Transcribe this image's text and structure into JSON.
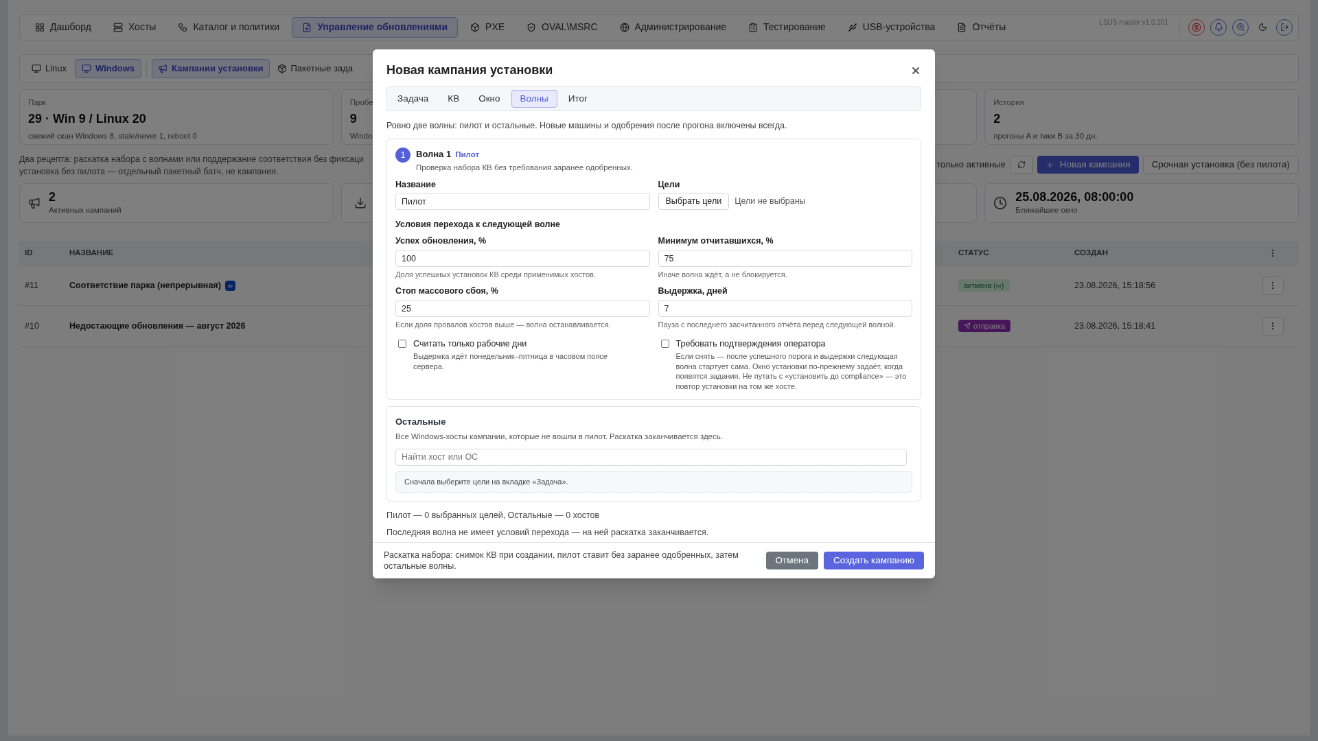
{
  "nav": {
    "tabs": [
      {
        "label": "Дашборд",
        "selected": false
      },
      {
        "label": "Хосты",
        "selected": false
      },
      {
        "label": "Каталог и политики",
        "selected": false
      },
      {
        "label": "Управление обновлениями",
        "selected": true
      },
      {
        "label": "PXE",
        "selected": false
      },
      {
        "label": "OVAL\\MSRC",
        "selected": false
      },
      {
        "label": "Администрирование",
        "selected": false
      },
      {
        "label": "Тестирование",
        "selected": false
      },
      {
        "label": "USB-устройства",
        "selected": false
      },
      {
        "label": "Отчёты",
        "selected": false
      }
    ],
    "version": "LSUS master v1.0.101"
  },
  "subnav": {
    "os_tabs": [
      {
        "label": "Linux",
        "selected": false
      },
      {
        "label": "Windows",
        "selected": true
      }
    ],
    "sections": [
      {
        "label": "Кампании установки",
        "selected": true
      },
      {
        "label": "Пакетные зада",
        "selected": false
      }
    ]
  },
  "stats_top": [
    {
      "label": "Парк",
      "value": "29 · Win 9 / Linux 20",
      "note": "свежий скан Windows 8, stale/never 1, reboot 0"
    },
    {
      "label": "Пробе",
      "value": "9",
      "note": "Windo"
    },
    {
      "label": "История",
      "value": "2",
      "note": "прогоны A и тики B за 30 дн."
    }
  ],
  "description": [
    "Два рецепта: раскатка набора с волнами или поддержание соответствия без фиксаци",
    "установка без пилота — отдельный пакетный батч, не кампания."
  ],
  "toolbar": {
    "filter_label": "только активные",
    "new_button": "Новая кампания",
    "urgent_button": "Срочная установка (без пилота)"
  },
  "stats_bottom": [
    {
      "value": "2",
      "label": "Активных кампаний"
    },
    {
      "value": "25.08.2026, 08:00:00",
      "label": "Ближайшее окно"
    }
  ],
  "table": {
    "columns": [
      "ID",
      "НАЗВАНИЕ",
      "СТАТУС",
      "СОЗДАН"
    ],
    "rows": [
      {
        "id": "#11",
        "name": "Соответствие парка (непрерывная)",
        "badge": "∞",
        "status": {
          "text": "активна (∞)",
          "kind": "active"
        },
        "created": "23.08.2026, 15:18:56"
      },
      {
        "id": "#10",
        "name": "Недостающие обновления — август 2026",
        "status": {
          "text": "отправка",
          "kind": "sending"
        },
        "created": "23.08.2026, 15:18:41"
      }
    ]
  },
  "modal": {
    "title": "Новая кампания установки",
    "tabs": [
      {
        "label": "Задача",
        "selected": false
      },
      {
        "label": "КВ",
        "selected": false
      },
      {
        "label": "Окно",
        "selected": false
      },
      {
        "label": "Волны",
        "selected": true
      },
      {
        "label": "Итог",
        "selected": false
      }
    ],
    "intro": "Ровно две волны: пилот и остальные. Новые машины и одобрения после прогона включены всегда.",
    "wave": {
      "number": "1",
      "title": "Волна 1",
      "tag": "Пилот",
      "description": "Проверка набора КВ без требования заранее одобренных.",
      "name_label": "Название",
      "name_value": "Пилот",
      "targets_label": "Цели",
      "targets_button": "Выбрать цели",
      "targets_note": "Цели не выбраны",
      "conditions_title": "Условия перехода к следующей волне",
      "conditions": [
        {
          "label": "Успех обновления, %",
          "value": "100",
          "hint": "Доля успешных установок КВ среди применимых хостов."
        },
        {
          "label": "Минимум отчитавшихся, %",
          "value": "75",
          "hint": "Иначе волна ждёт, а не блокируется."
        },
        {
          "label": "Стоп массового сбоя, %",
          "value": "25",
          "hint": "Если доля провалов хостов выше — волна останавливается."
        },
        {
          "label": "Выдержка, дней",
          "value": "7",
          "hint": "Пауза с последнего засчитанного отчёта перед следующей волной."
        }
      ],
      "checkboxes": [
        {
          "label": "Считать только рабочие дни",
          "hint": "Выдержка идёт понедельник–пятница в часовом поясе сервера.",
          "checked": false
        },
        {
          "label": "Требовать подтверждения оператора",
          "hint": "Если снять — после успешного порога и выдержки следующая волна стартует сама. Окно установки по-прежнему задаёт, когда появятся задания. Не путать с «установить до compliance» — это повтор установки на том же хосте.",
          "checked": false
        }
      ]
    },
    "rest": {
      "title": "Остальные",
      "description": "Все Windows-хосты кампании, которые не вошли в пилот. Раскатка заканчивается здесь.",
      "search_placeholder": "Найти хост или ОС",
      "empty": "Сначала выберите цели на вкладке «Задача»."
    },
    "summary": "Пилот — 0 выбранных целей, Остальные — 0 хостов",
    "last_note": "Последняя волна не имеет условий перехода — на ней раскатка заканчивается.",
    "footer_note": "Раскатка набора: снимок КВ при создании, пилот ставит без заранее одобренных, затем остальные волны.",
    "cancel": "Отмена",
    "submit": "Создать кампанию"
  }
}
